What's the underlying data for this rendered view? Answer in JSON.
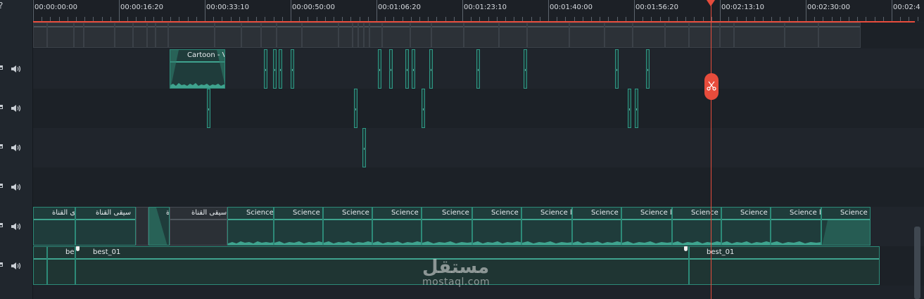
{
  "header": {
    "help_label": "?"
  },
  "ruler": {
    "timecodes": [
      "00:00:00:00",
      "00:00:16:20",
      "00:00:33:10",
      "00:00:50:00",
      "00:01:06:20",
      "00:01:23:10",
      "00:01:40:00",
      "00:01:56:20",
      "00:02:13:10",
      "00:02:30:00",
      "00:02:4"
    ]
  },
  "tracks": {
    "video_top": {
      "clip_label": "Cartoon - V"
    },
    "music": {
      "clips": [
        "ى القناة",
        "سيقى القناة",
        "ة",
        "سيقى القناة",
        "Science",
        "Science b",
        "Science b",
        "Science b",
        "Science b",
        "Science b",
        "Science b",
        "Science b",
        "Science b",
        "Science b",
        "Science b",
        "Science b",
        "Science b"
      ]
    },
    "voice": {
      "clips": [
        "",
        "be",
        "best_01",
        "best_01"
      ]
    }
  },
  "watermark": {
    "arabic": "مستقل",
    "latin": "mostaql.com"
  },
  "colors": {
    "accent": "#e74c3c",
    "clip": "#2d8a78",
    "background": "#1e232a"
  },
  "icons": {
    "lock": "lock-icon",
    "speaker": "speaker-icon",
    "scissors": "scissors-icon"
  }
}
